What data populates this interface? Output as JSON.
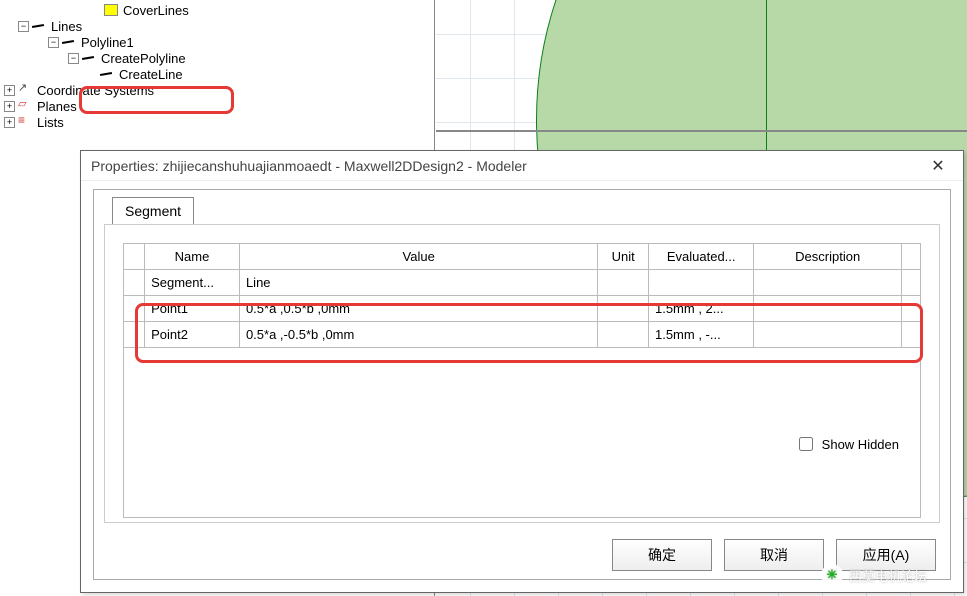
{
  "tree": {
    "coverlines": "CoverLines",
    "lines": "Lines",
    "polyline1": "Polyline1",
    "createpolyline": "CreatePolyline",
    "createline": "CreateLine",
    "coord": "Coordinate Systems",
    "planes": "Planes",
    "lists": "Lists"
  },
  "dialog": {
    "title": "Properties: zhijiecanshuhuajianmoaedt - Maxwell2DDesign2 - Modeler",
    "close": "✕",
    "tab": "Segment",
    "show_hidden_label": "Show Hidden",
    "buttons": {
      "ok": "确定",
      "cancel": "取消",
      "apply": "应用(A)"
    }
  },
  "table": {
    "headers": {
      "name": "Name",
      "value": "Value",
      "unit": "Unit",
      "eval": "Evaluated...",
      "desc": "Description"
    },
    "rows": [
      {
        "name": "Segment...",
        "value": "Line",
        "unit": "",
        "eval": "",
        "desc": ""
      },
      {
        "name": "Point1",
        "value": "0.5*a ,0.5*b ,0mm",
        "unit": "",
        "eval": "1.5mm , 2...",
        "desc": ""
      },
      {
        "name": "Point2",
        "value": "0.5*a ,-0.5*b ,0mm",
        "unit": "",
        "eval": "1.5mm , -...",
        "desc": ""
      }
    ]
  },
  "watermark": {
    "text": "西莫电机论坛"
  },
  "colors": {
    "highlight": "#e53935",
    "circle": "#b7d9a8"
  }
}
